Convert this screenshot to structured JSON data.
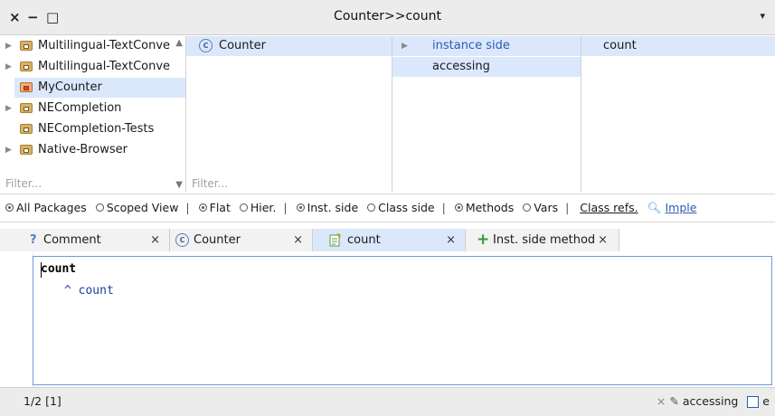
{
  "window": {
    "title": "Counter>>count",
    "close_glyph": "×",
    "minimize_glyph": "−",
    "maximize_glyph": "□",
    "menu_glyph": "▾"
  },
  "packages": {
    "items": [
      {
        "label": "Multilingual-TextConve",
        "expandable": true
      },
      {
        "label": "Multilingual-TextConve",
        "expandable": true
      },
      {
        "label": "MyCounter",
        "expandable": false,
        "selected": true
      },
      {
        "label": "NECompletion",
        "expandable": true
      },
      {
        "label": "NECompletion-Tests",
        "expandable": false
      },
      {
        "label": "Native-Browser",
        "expandable": true
      }
    ],
    "filter_placeholder": "Filter..."
  },
  "classes": {
    "items": [
      {
        "label": "Counter",
        "badge": "C",
        "selected": true
      }
    ],
    "filter_placeholder": "Filter..."
  },
  "protocols": {
    "items": [
      {
        "label": "instance side",
        "expandable": true
      },
      {
        "label": "accessing"
      }
    ]
  },
  "methods": {
    "items": [
      {
        "label": "count",
        "selected": true
      }
    ]
  },
  "scope_bar": {
    "all_packages": "All Packages",
    "scoped_view": "Scoped View",
    "flat": "Flat",
    "hier": "Hier.",
    "inst_side": "Inst. side",
    "class_side": "Class side",
    "methods": "Methods",
    "vars": "Vars",
    "class_refs": "Class refs.",
    "imple": "Imple"
  },
  "tabs": [
    {
      "label": "Comment",
      "icon": "?"
    },
    {
      "label": "Counter",
      "icon": "C"
    },
    {
      "label": "count",
      "icon": "method-icon"
    },
    {
      "label": "Inst. side method",
      "icon": "+"
    }
  ],
  "editor": {
    "line1": "count",
    "line2": "^ count"
  },
  "status": {
    "position": "1/2 [1]",
    "protocol": "accessing",
    "flag_label": "e"
  },
  "colors": {
    "selection": "#dbe8fb",
    "accent": "#2a5db0"
  }
}
